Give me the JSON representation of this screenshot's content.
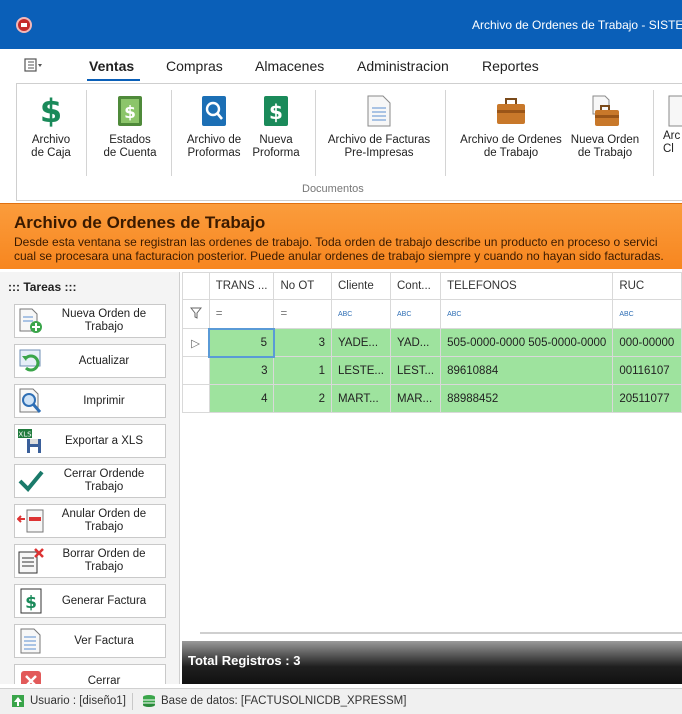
{
  "window": {
    "title": "Archivo de Ordenes de Trabajo - SISTEMA D"
  },
  "menu": {
    "tabs": [
      "Ventas",
      "Compras",
      "Almacenes",
      "Administracion",
      "Reportes"
    ]
  },
  "ribbon": {
    "buttons": [
      {
        "label": "Archivo\nde Caja",
        "icon": "dollar-icon"
      },
      {
        "label": "Estados\nde Cuenta",
        "icon": "money-book-icon"
      },
      {
        "label": "Archivo de\nProformas",
        "icon": "search-document-icon"
      },
      {
        "label": "Nueva\nProforma",
        "icon": "dollar-document-icon"
      },
      {
        "label": "Archivo de Facturas\nPre-Impresas",
        "icon": "document-icon"
      },
      {
        "label": "Archivo de Ordenes\nde Trabajo",
        "icon": "briefcase-icon"
      },
      {
        "label": "Nueva Orden\nde Trabajo",
        "icon": "briefcase-new-icon"
      },
      {
        "label": "Arc\nCl",
        "icon": "document-icon"
      }
    ],
    "group_label": "Documentos"
  },
  "banner": {
    "title": "Archivo de Ordenes de Trabajo",
    "description": "Desde esta ventana se registran las ordenes de trabajo. Toda orden de trabajo describe un producto en proceso o servici\ncual se procesara una facturacion posterior. Puede anular ordenes de trabajo siempre y cuando no hayan sido facturadas."
  },
  "tasks": {
    "title": "::: Tareas :::",
    "buttons": [
      {
        "label": "Nueva Orden de Trabajo",
        "icon": "new-document-icon"
      },
      {
        "label": "Actualizar",
        "icon": "refresh-icon"
      },
      {
        "label": "Imprimir",
        "icon": "print-preview-icon"
      },
      {
        "label": "Exportar a XLS",
        "icon": "xls-export-icon"
      },
      {
        "label": "Cerrar Ordende Trabajo",
        "icon": "checkmark-icon"
      },
      {
        "label": "Anular Orden de Trabajo",
        "icon": "cancel-document-icon"
      },
      {
        "label": "Borrar Orden de Trabajo",
        "icon": "delete-document-icon"
      },
      {
        "label": "Generar Factura",
        "icon": "dollar-icon"
      },
      {
        "label": "Ver Factura",
        "icon": "view-document-icon"
      },
      {
        "label": "Cerrar",
        "icon": "close-icon"
      }
    ]
  },
  "grid": {
    "columns": [
      "TRANS ...",
      "No OT",
      "Cliente",
      "Cont...",
      "TELEFONOS",
      "RUC"
    ],
    "filter_symbols": [
      "=",
      "=",
      "ABC",
      "ABC",
      "ABC",
      "ABC"
    ],
    "rows": [
      [
        "5",
        "3",
        "YADE...",
        "YAD...",
        "505-0000-0000 505-0000-0000",
        "000-00000"
      ],
      [
        "3",
        "1",
        "LESTE...",
        "LEST...",
        "89610884",
        "00116107"
      ],
      [
        "4",
        "2",
        "MART...",
        "MAR...",
        "88988452",
        "20511077"
      ]
    ],
    "total_label": "Total Registros : 3"
  },
  "status": {
    "user": "Usuario : [diseño1]",
    "database": "Base de datos: [FACTUSOLNICDB_XPRESSM]"
  },
  "colors": {
    "title_bar": "#0a5fb8",
    "banner": "#f7861f",
    "row_highlight": "#9ee39e"
  }
}
